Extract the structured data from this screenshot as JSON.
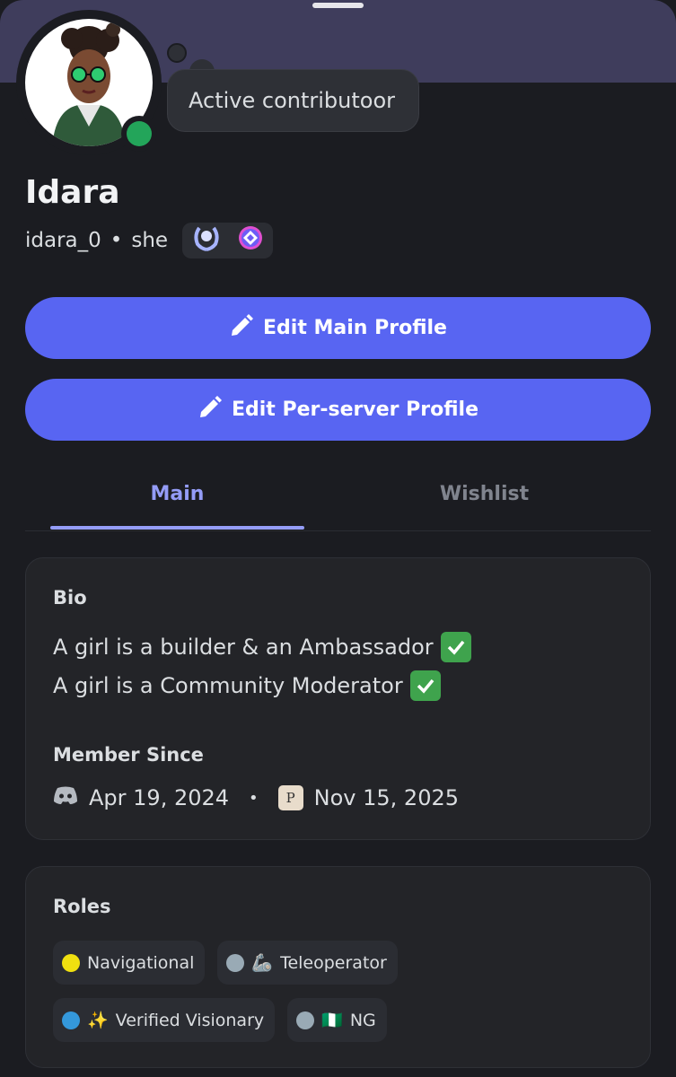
{
  "profile": {
    "display_name": "Idara",
    "username": "idara_0",
    "separator": "•",
    "pronouns": "she",
    "custom_status": "Active contributoor",
    "online_status_color": "#23a55a",
    "badges": [
      "hypesquad-laurel-icon",
      "nitro-gem-icon"
    ]
  },
  "actions": {
    "edit_main": "Edit Main Profile",
    "edit_server": "Edit Per-server Profile"
  },
  "tabs": [
    {
      "label": "Main",
      "active": true
    },
    {
      "label": "Wishlist",
      "active": false
    }
  ],
  "bio": {
    "title": "Bio",
    "lines": [
      "A girl is a builder & an Ambassador",
      "A girl is a Community Moderator"
    ]
  },
  "member_since": {
    "title": "Member Since",
    "discord_date": "Apr 19, 2024",
    "separator": "•",
    "server_date": "Nov 15, 2025"
  },
  "roles": {
    "title": "Roles",
    "items": [
      {
        "dot": "#f0e010",
        "emoji": "",
        "name": "Navigational"
      },
      {
        "dot": "#99aab5",
        "emoji": "🦾",
        "name": "Teleoperator"
      },
      {
        "dot": "#3498db",
        "emoji": "✨",
        "name": "Verified Visionary"
      },
      {
        "dot": "#99aab5",
        "emoji": "🇳🇬",
        "name": "NG"
      }
    ]
  },
  "colors": {
    "background": "#1b1c21",
    "accent": "#5865f2",
    "tab_active": "#949cf7",
    "card": "#232428"
  }
}
